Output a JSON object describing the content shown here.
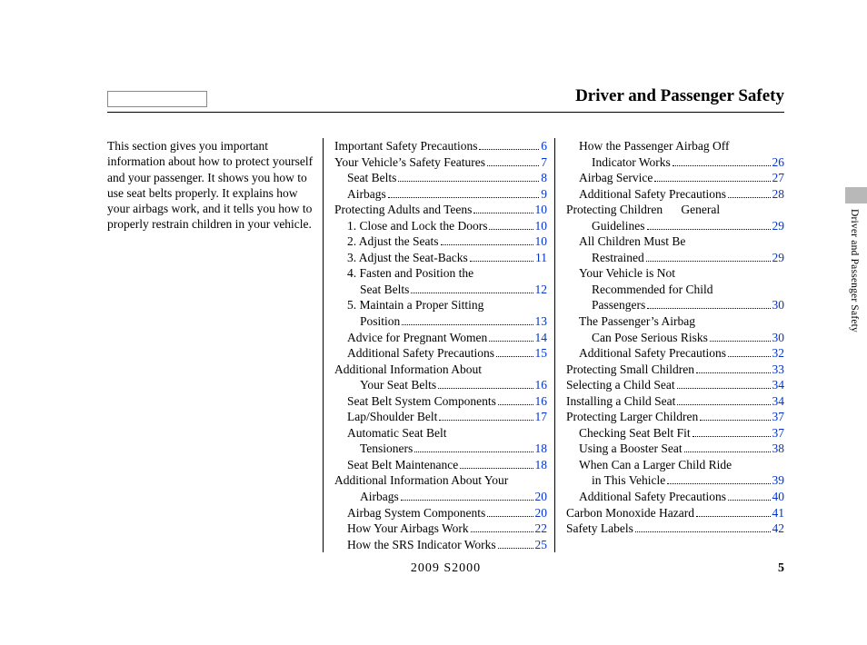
{
  "header": {
    "title": "Driver and Passenger Safety"
  },
  "side_label": "Driver and Passenger Safety",
  "footer": {
    "model": "2009  S2000",
    "page": "5"
  },
  "intro": "This section gives you important information about how to protect yourself and your passenger. It shows you how to use seat belts properly. It explains how your airbags work, and it tells you how to properly restrain children in your vehicle.",
  "toc_col2": [
    {
      "t": "line",
      "label": "Important Safety Precautions",
      "page": "6",
      "indent": 0
    },
    {
      "t": "line",
      "label": "Your Vehicle’s Safety Features",
      "page": "7",
      "indent": 0
    },
    {
      "t": "line",
      "label": "Seat Belts",
      "page": "8",
      "indent": 1
    },
    {
      "t": "line",
      "label": "Airbags",
      "page": "9",
      "indent": 1
    },
    {
      "t": "line",
      "label": "Protecting Adults and Teens",
      "page": "10",
      "indent": 0
    },
    {
      "t": "line",
      "label": "1. Close and Lock the Doors",
      "page": "10",
      "indent": 1
    },
    {
      "t": "line",
      "label": "2. Adjust the Seats",
      "page": "10",
      "indent": 1
    },
    {
      "t": "line",
      "label": "3. Adjust the Seat-Backs",
      "page": "11",
      "indent": 1
    },
    {
      "t": "cont",
      "label": "4. Fasten and Position the",
      "indent": 1
    },
    {
      "t": "line",
      "label": "Seat Belts",
      "page": "12",
      "indent": 2
    },
    {
      "t": "cont",
      "label": "5. Maintain a Proper Sitting",
      "indent": 1
    },
    {
      "t": "line",
      "label": "Position",
      "page": "13",
      "indent": 2
    },
    {
      "t": "line",
      "label": "Advice for Pregnant Women",
      "page": "14",
      "indent": 1
    },
    {
      "t": "line",
      "label": "Additional Safety Precautions",
      "page": "15",
      "indent": 1
    },
    {
      "t": "cont",
      "label": "Additional Information About",
      "indent": 0
    },
    {
      "t": "line",
      "label": "Your Seat Belts",
      "page": "16",
      "indent": 2
    },
    {
      "t": "line",
      "label": "Seat Belt System Components",
      "page": "16",
      "indent": 1
    },
    {
      "t": "line",
      "label": "Lap/Shoulder Belt",
      "page": "17",
      "indent": 1
    },
    {
      "t": "cont",
      "label": "Automatic Seat Belt",
      "indent": 1
    },
    {
      "t": "line",
      "label": "Tensioners",
      "page": "18",
      "indent": 2
    },
    {
      "t": "line",
      "label": "Seat Belt Maintenance",
      "page": "18",
      "indent": 1
    },
    {
      "t": "cont",
      "label": "Additional Information About Your",
      "indent": 0
    },
    {
      "t": "line",
      "label": "Airbags",
      "page": "20",
      "indent": 2
    },
    {
      "t": "line",
      "label": "Airbag System Components",
      "page": "20",
      "indent": 1
    },
    {
      "t": "line",
      "label": "How Your Airbags Work",
      "page": "22",
      "indent": 1
    },
    {
      "t": "line",
      "label": "How the SRS Indicator Works",
      "page": "25",
      "indent": 1
    }
  ],
  "toc_col3": [
    {
      "t": "cont",
      "label": "How the Passenger Airbag Off",
      "indent": 1
    },
    {
      "t": "line",
      "label": "Indicator Works",
      "page": "26",
      "indent": 2
    },
    {
      "t": "line",
      "label": "Airbag Service",
      "page": "27",
      "indent": 1
    },
    {
      "t": "line",
      "label": "Additional Safety Precautions",
      "page": "28",
      "indent": 1
    },
    {
      "t": "cont",
      "label": "Protecting Children    General",
      "indent": 0
    },
    {
      "t": "line",
      "label": "Guidelines",
      "page": "29",
      "indent": 2
    },
    {
      "t": "cont",
      "label": "All Children Must Be",
      "indent": 1
    },
    {
      "t": "line",
      "label": "Restrained",
      "page": "29",
      "indent": 2
    },
    {
      "t": "cont",
      "label": "Your Vehicle is Not",
      "indent": 1
    },
    {
      "t": "cont",
      "label": "Recommended for Child",
      "indent": 2
    },
    {
      "t": "line",
      "label": "Passengers",
      "page": "30",
      "indent": 2
    },
    {
      "t": "cont",
      "label": "The Passenger’s Airbag",
      "indent": 1
    },
    {
      "t": "line",
      "label": "Can Pose Serious Risks",
      "page": "30",
      "indent": 2
    },
    {
      "t": "line",
      "label": "Additional Safety Precautions",
      "page": "32",
      "indent": 1
    },
    {
      "t": "line",
      "label": "Protecting Small Children",
      "page": "33",
      "indent": 0
    },
    {
      "t": "line",
      "label": "Selecting a Child Seat",
      "page": "34",
      "indent": 0
    },
    {
      "t": "line",
      "label": "Installing a Child Seat",
      "page": "34",
      "indent": 0
    },
    {
      "t": "line",
      "label": "Protecting Larger Children",
      "page": "37",
      "indent": 0
    },
    {
      "t": "line",
      "label": "Checking Seat Belt Fit",
      "page": "37",
      "indent": 1
    },
    {
      "t": "line",
      "label": "Using a Booster Seat",
      "page": "38",
      "indent": 1
    },
    {
      "t": "cont",
      "label": "When Can a Larger Child Ride",
      "indent": 1
    },
    {
      "t": "line",
      "label": "in This Vehicle",
      "page": "39",
      "indent": 2
    },
    {
      "t": "line",
      "label": "Additional Safety Precautions",
      "page": "40",
      "indent": 1
    },
    {
      "t": "line",
      "label": "Carbon Monoxide Hazard",
      "page": "41",
      "indent": 0
    },
    {
      "t": "line",
      "label": "Safety Labels",
      "page": "42",
      "indent": 0
    }
  ]
}
